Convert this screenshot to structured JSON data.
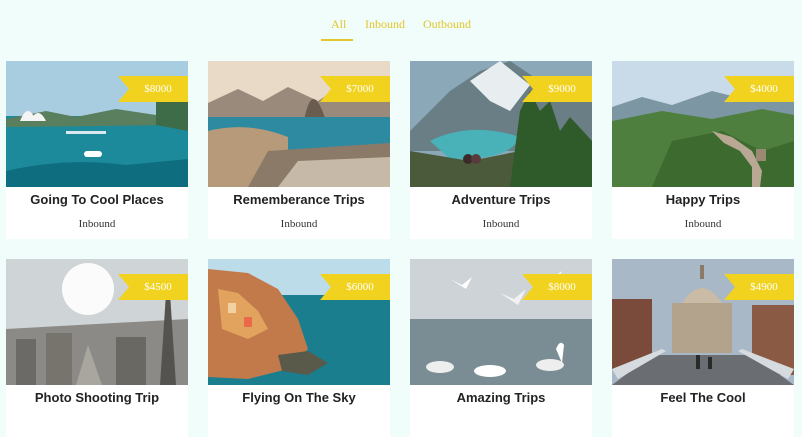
{
  "filters": {
    "tabs": [
      "All",
      "Inbound",
      "Outbound"
    ],
    "active": "All"
  },
  "accent_color": "#f1d21f",
  "cards": [
    {
      "title": "Going To Cool Places",
      "category": "Inbound",
      "price": "$8000"
    },
    {
      "title": "Rememberance Trips",
      "category": "Inbound",
      "price": "$7000"
    },
    {
      "title": "Adventure Trips",
      "category": "Inbound",
      "price": "$9000"
    },
    {
      "title": "Happy Trips",
      "category": "Inbound",
      "price": "$4000"
    },
    {
      "title": "Photo Shooting Trip",
      "category": "",
      "price": "$4500"
    },
    {
      "title": "Flying On The Sky",
      "category": "",
      "price": "$6000"
    },
    {
      "title": "Amazing Trips",
      "category": "",
      "price": "$8000"
    },
    {
      "title": "Feel The Cool",
      "category": "",
      "price": "$4900"
    }
  ]
}
